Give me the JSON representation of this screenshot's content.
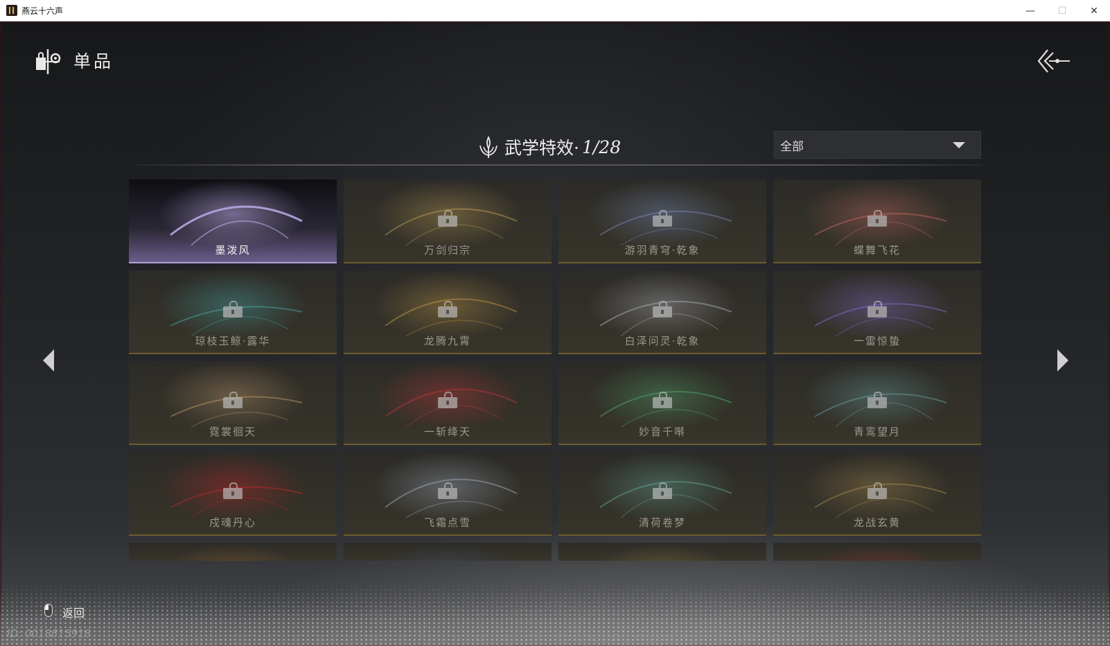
{
  "window": {
    "title": "燕云十六声",
    "minimize": "—",
    "maximize": "☐",
    "close": "✕"
  },
  "header": {
    "title": "单品",
    "icon": "shop-icon",
    "back_icon": "back-arrows-icon"
  },
  "section": {
    "title": "武学特效·",
    "count": "1/28",
    "icon": "lotus-flame-icon"
  },
  "filter": {
    "selected": "全部"
  },
  "items": [
    {
      "name": "墨泼风",
      "unlocked": true,
      "accent": "#b5a6e0"
    },
    {
      "name": "万剑归宗",
      "unlocked": false,
      "accent": "#c8a458"
    },
    {
      "name": "游羽青穹·乾象",
      "unlocked": false,
      "accent": "#7f93c4"
    },
    {
      "name": "蝶舞飞花",
      "unlocked": false,
      "accent": "#d07068"
    },
    {
      "name": "琼枝玉鲸·露华",
      "unlocked": false,
      "accent": "#4fb0b0"
    },
    {
      "name": "龙腾九霄",
      "unlocked": false,
      "accent": "#c9a04a"
    },
    {
      "name": "白泽问灵·乾象",
      "unlocked": false,
      "accent": "#b8b8c0"
    },
    {
      "name": "一雷惊蛰",
      "unlocked": false,
      "accent": "#8a74d8"
    },
    {
      "name": "霓裳徊天",
      "unlocked": false,
      "accent": "#c8a070"
    },
    {
      "name": "一斩绛天",
      "unlocked": false,
      "accent": "#c83a3a"
    },
    {
      "name": "妙音千啭",
      "unlocked": false,
      "accent": "#58b070"
    },
    {
      "name": "青鸾望月",
      "unlocked": false,
      "accent": "#6fa6a8"
    },
    {
      "name": "戍魂丹心",
      "unlocked": false,
      "accent": "#c82828"
    },
    {
      "name": "飞霜点雪",
      "unlocked": false,
      "accent": "#a8b4c8"
    },
    {
      "name": "清荷卷梦",
      "unlocked": false,
      "accent": "#6ab0a0"
    },
    {
      "name": "龙战玄黄",
      "unlocked": false,
      "accent": "#b09050"
    },
    {
      "name": "",
      "unlocked": false,
      "accent": "#b07040"
    },
    {
      "name": "",
      "unlocked": false,
      "accent": "#4a5a90"
    },
    {
      "name": "",
      "unlocked": false,
      "accent": "#a0904a"
    },
    {
      "name": "",
      "unlocked": false,
      "accent": "#b03030"
    }
  ],
  "footer": {
    "back_label": "返回",
    "id_text": "ID: 0018815918"
  }
}
